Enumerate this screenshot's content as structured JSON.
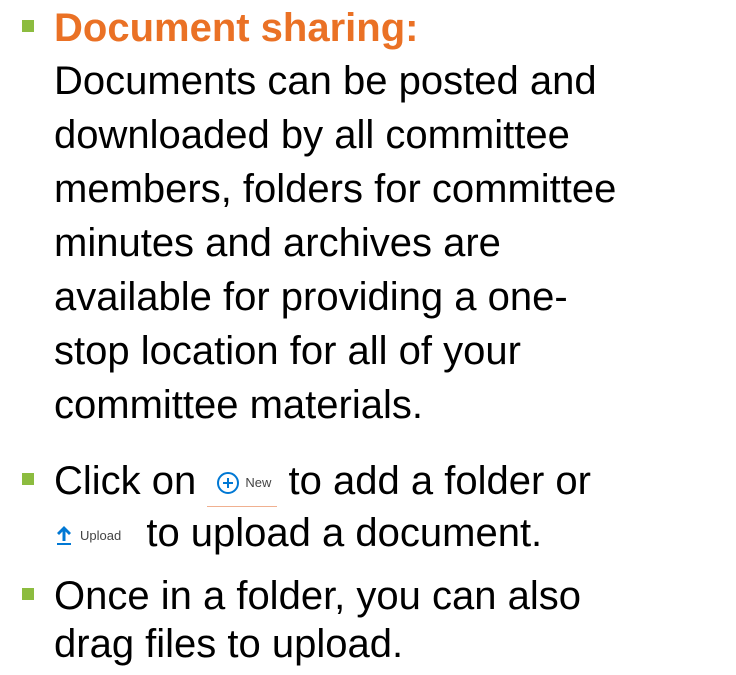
{
  "colors": {
    "bullet": "#8cbc3f",
    "heading": "#ea7125",
    "icon_accent": "#0078d4"
  },
  "items": [
    {
      "heading": "Document sharing:",
      "lines": [
        "Documents can be posted and",
        "downloaded by all committee",
        "members, folders for committee",
        "minutes and archives are",
        "available for providing a one-",
        "stop location for all of your",
        "committee materials."
      ]
    },
    {
      "line1_prefix": "Click on",
      "new_button_label": "New",
      "line1_suffix": "to add a folder or",
      "upload_button_label": "Upload",
      "line2_suffix": "to upload a document."
    },
    {
      "lines": [
        "Once in a folder, you can also",
        "drag files to upload."
      ]
    }
  ]
}
